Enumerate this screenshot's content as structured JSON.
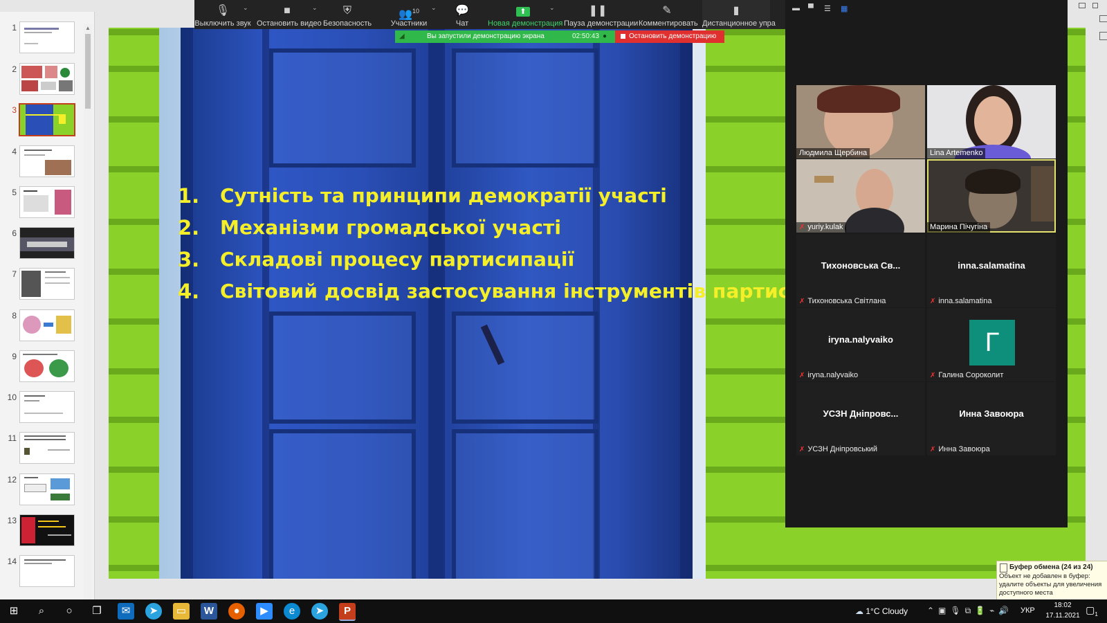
{
  "powerpoint": {
    "slides": [
      {
        "num": "1"
      },
      {
        "num": "2"
      },
      {
        "num": "3"
      },
      {
        "num": "4"
      },
      {
        "num": "5"
      },
      {
        "num": "6"
      },
      {
        "num": "7"
      },
      {
        "num": "8"
      },
      {
        "num": "9"
      },
      {
        "num": "10"
      },
      {
        "num": "11"
      },
      {
        "num": "12"
      },
      {
        "num": "13"
      },
      {
        "num": "14"
      }
    ],
    "active_slide": "3",
    "slide_content": {
      "items": [
        {
          "num": "1.",
          "text": "Сутність та принципи демократії участі"
        },
        {
          "num": "2.",
          "text": "Механізми громадської участі"
        },
        {
          "num": "3.",
          "text": "Складові процесу партисипації"
        },
        {
          "num": "4.",
          "text": "Світовий досвід застосування інструментів партисипації"
        }
      ]
    }
  },
  "zoom": {
    "toolbar": {
      "mute_label": "Выключить звук",
      "video_label": "Остановить видео",
      "security_label": "Безопасность",
      "participants_label": "Участники",
      "participants_count": "10",
      "chat_label": "Чат",
      "new_share_label": "Новая демонстрация",
      "pause_share_label": "Пауза демонстрации",
      "annotate_label": "Комментировать",
      "remote_label": "Дистанционное упра"
    },
    "share_status": {
      "text": "Вы запустили демонстрацию экрана",
      "time": "02:50:43",
      "stop_label": "Остановить демонстрацию"
    },
    "participants": [
      {
        "name": "Людмила Щербина",
        "type": "video"
      },
      {
        "name": "Lina Artemenko",
        "type": "video"
      },
      {
        "name": "yuriy.kulak",
        "type": "video",
        "muted": true
      },
      {
        "name": "Марина Пічугіна",
        "type": "video",
        "highlight": true
      },
      {
        "display": "Тихоновська  Св...",
        "name": "Тихоновська Світлана",
        "muted": true
      },
      {
        "display": "inna.salamatina",
        "name": "inna.salamatina",
        "muted": true
      },
      {
        "display": "iryna.nalyvaiko",
        "name": "iryna.nalyvaiko",
        "muted": true
      },
      {
        "avatar_letter": "Г",
        "name": "Галина Сороколит",
        "muted": true,
        "avatar_color": "#0d8f7c"
      },
      {
        "display": "УСЗН  Дніпровс...",
        "name": "УСЗН Дніпровський",
        "muted": true
      },
      {
        "display": "Инна Завоюра",
        "name": "Инна Завоюра",
        "muted": true
      }
    ]
  },
  "clipboard_notice": {
    "title": "Буфер обмена (24 из 24)",
    "body": "Объект не добавлен в буфер: удалите объекты для увеличения доступного места"
  },
  "taskbar": {
    "weather": "1°C  Cloudy",
    "language": "УКР",
    "time": "18:02",
    "date": "17.11.2021",
    "notification_count": "1"
  }
}
